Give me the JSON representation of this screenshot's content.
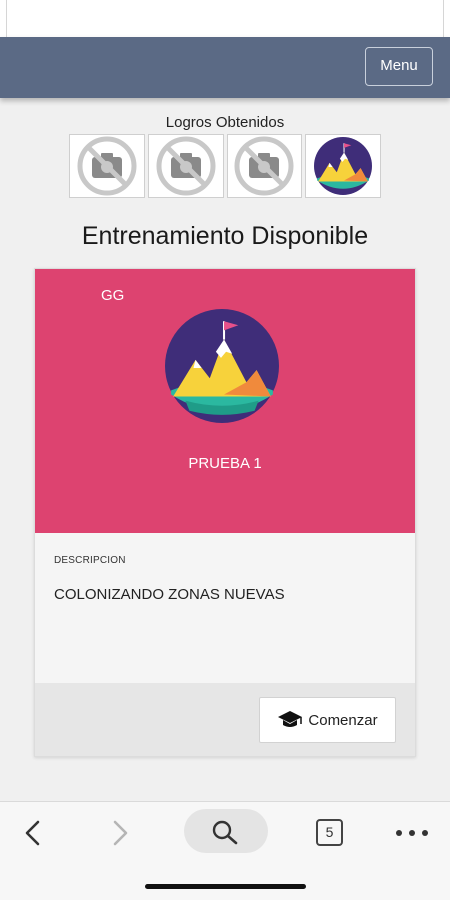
{
  "header": {
    "menu_label": "Menu"
  },
  "achievements": {
    "title": "Logros Obtenidos",
    "badges": [
      {
        "state": "locked",
        "icon": "no-photo-icon"
      },
      {
        "state": "locked",
        "icon": "no-photo-icon"
      },
      {
        "state": "locked",
        "icon": "no-photo-icon"
      },
      {
        "state": "earned",
        "icon": "mountain-flag-icon"
      }
    ]
  },
  "main": {
    "title": "Entrenamiento Disponible"
  },
  "training_card": {
    "author": "GG",
    "name": "PRUEBA 1",
    "description_label": "DESCRIPCION",
    "description": "COLONIZANDO ZONAS NUEVAS",
    "start_label": "Comenzar",
    "start_icon": "graduation-cap-icon",
    "hero_color": "#dd4370"
  },
  "browser_bar": {
    "tabs_count": "5",
    "icons": [
      "back-arrow-icon",
      "forward-arrow-icon",
      "search-icon",
      "tabs-icon",
      "more-icon"
    ]
  },
  "colors": {
    "navbar": "#5b6a85",
    "card_hero": "#dd4370",
    "background": "#f0f0f0"
  }
}
